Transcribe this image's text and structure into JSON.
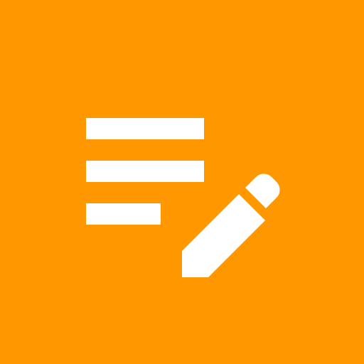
{
  "icon": {
    "name": "notes-edit-icon",
    "background_color": "#FF9800",
    "glyph_color": "#FFFFFF"
  }
}
